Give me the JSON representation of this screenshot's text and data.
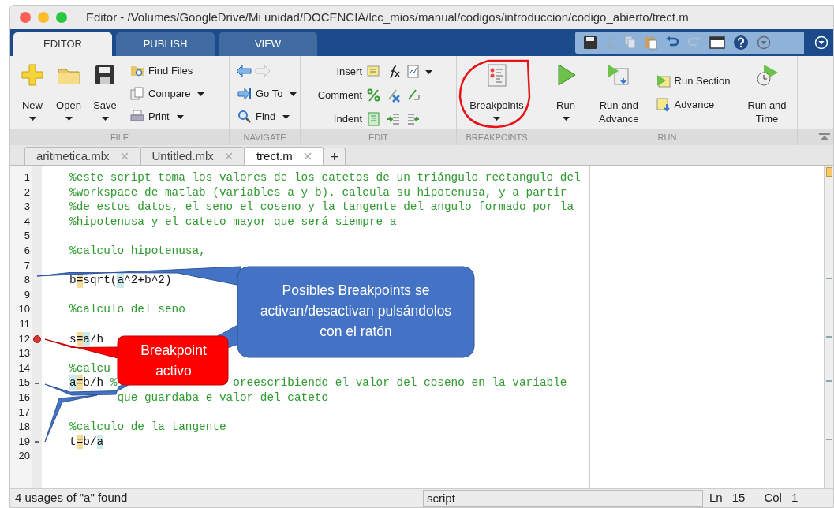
{
  "window": {
    "title": "Editor - /Volumes/GoogleDrive/Mi unidad/DOCENCIA/lcc_mios/manual/codigos/introduccion/codigo_abierto/trect.m"
  },
  "ribbon_tabs": [
    {
      "label": "EDITOR",
      "selected": true
    },
    {
      "label": "PUBLISH",
      "selected": false
    },
    {
      "label": "VIEW",
      "selected": false
    }
  ],
  "ribbon_sections": [
    {
      "label": "FILE",
      "items": [
        {
          "kind": "large",
          "label": "New",
          "dropdown": true
        },
        {
          "kind": "large",
          "label": "Open",
          "dropdown": true
        },
        {
          "kind": "large",
          "label": "Save",
          "dropdown": true
        },
        {
          "kind": "small",
          "label": "Find Files",
          "dropdown": false
        },
        {
          "kind": "small",
          "label": "Compare",
          "dropdown": true
        },
        {
          "kind": "small",
          "label": "Print",
          "dropdown": true
        }
      ]
    },
    {
      "label": "NAVIGATE",
      "items": [
        {
          "kind": "arrows"
        },
        {
          "kind": "small",
          "label": "Go To",
          "dropdown": true
        },
        {
          "kind": "small",
          "label": "Find",
          "dropdown": true
        }
      ]
    },
    {
      "label": "EDIT",
      "items": [
        {
          "kind": "iconrow",
          "label": "Insert",
          "dropdown": true
        },
        {
          "kind": "iconrow",
          "label": "Comment",
          "dropdown": false
        },
        {
          "kind": "iconrow",
          "label": "Indent",
          "dropdown": false
        }
      ]
    },
    {
      "label": "BREAKPOINTS",
      "items": [
        {
          "kind": "large",
          "label": "Breakpoints",
          "dropdown": true,
          "circled": true
        }
      ]
    },
    {
      "label": "RUN",
      "items": [
        {
          "kind": "large",
          "label": "Run",
          "dropdown": true
        },
        {
          "kind": "large",
          "label": "Run and Advance",
          "dropdown": false
        },
        {
          "kind": "small",
          "label": "Run Section",
          "dropdown": false
        },
        {
          "kind": "small",
          "label": "Advance",
          "dropdown": false
        },
        {
          "kind": "large",
          "label": "Run and Time",
          "dropdown": false
        }
      ]
    }
  ],
  "editor_tabs": [
    {
      "label": "aritmetica.mlx",
      "selected": false
    },
    {
      "label": "Untitled.mlx",
      "selected": false
    },
    {
      "label": "trect.m",
      "selected": true
    },
    {
      "label": "+",
      "kind": "add"
    }
  ],
  "lines": [
    {
      "number": "1",
      "code": [
        {
          "text": "%este script toma los valores de los catetos de un triángulo rectangulo del",
          "kind": "comment"
        }
      ]
    },
    {
      "number": "2",
      "code": [
        {
          "text": "%workspace de matlab (variables a y b). calcula su hipotenusa, y a partir",
          "kind": "comment"
        }
      ]
    },
    {
      "number": "3",
      "code": [
        {
          "text": "%de estos datos, el seno el coseno y la tangente del angulo formado por la",
          "kind": "comment"
        }
      ]
    },
    {
      "number": "4",
      "code": [
        {
          "text": "%hipotenusa y el cateto mayor que será siempre a",
          "kind": "comment"
        }
      ]
    },
    {
      "number": "5"
    },
    {
      "number": "6",
      "code": [
        {
          "text": "%calculo hipotenusa,",
          "kind": "comment"
        }
      ]
    },
    {
      "number": "7"
    },
    {
      "number": "8",
      "code": [
        {
          "text": "b",
          "kind": "plain"
        },
        {
          "text": "=",
          "kind": "assign"
        },
        {
          "text": "sqrt(",
          "kind": "plain"
        },
        {
          "text": "a",
          "kind": "usage"
        },
        {
          "text": "^2+b^2)",
          "kind": "plain"
        }
      ]
    },
    {
      "number": "9"
    },
    {
      "number": "10",
      "code": [
        {
          "text": "%calculo del seno",
          "kind": "comment"
        }
      ]
    },
    {
      "number": "11"
    },
    {
      "number": "12",
      "breakpoint": true,
      "code": [
        {
          "text": "s",
          "kind": "plain"
        },
        {
          "text": "=",
          "kind": "assign"
        },
        {
          "text": "a",
          "kind": "usage"
        },
        {
          "text": "/h",
          "kind": "plain"
        }
      ]
    },
    {
      "number": "13"
    },
    {
      "number": "14",
      "code": [
        {
          "text": "%calcu",
          "kind": "comment"
        }
      ]
    },
    {
      "number": "15",
      "breakpoint": false,
      "code": [
        {
          "text": "a",
          "kind": "usage"
        },
        {
          "text": "=",
          "kind": "assign"
        },
        {
          "text": "b/h",
          "kind": "plain"
        },
        {
          "text": "%",
          "kind": "comment"
        },
        {
          "text": "oreescribiendo el valor del coseno en la variable",
          "kind": "comment",
          "covered_before": true
        }
      ]
    },
    {
      "number": "16",
      "code": [
        {
          "text": "que guardaba e valor del cateto",
          "kind": "comment",
          "covered_before": true
        }
      ]
    },
    {
      "number": "17"
    },
    {
      "number": "18",
      "code": [
        {
          "text": "%calculo de la tangente",
          "kind": "comment"
        }
      ]
    },
    {
      "number": "19",
      "breakpoint": false,
      "code": [
        {
          "text": "t",
          "kind": "plain"
        },
        {
          "text": "=",
          "kind": "assign"
        },
        {
          "text": "b/",
          "kind": "plain"
        },
        {
          "text": "a",
          "kind": "usage"
        }
      ]
    },
    {
      "number": "20"
    }
  ],
  "callouts": [
    {
      "kind": "info",
      "text": "Posibles Breakpoints se activan/desactivan pulsándolos  con el ratón"
    },
    {
      "kind": "alert",
      "text": "Breakpoint activo"
    }
  ],
  "status_bar": {
    "message": "4 usages of \"a\" found",
    "file_type": "script",
    "ln_label": "Ln",
    "ln": "15",
    "col_label": "Col",
    "col": "1"
  }
}
